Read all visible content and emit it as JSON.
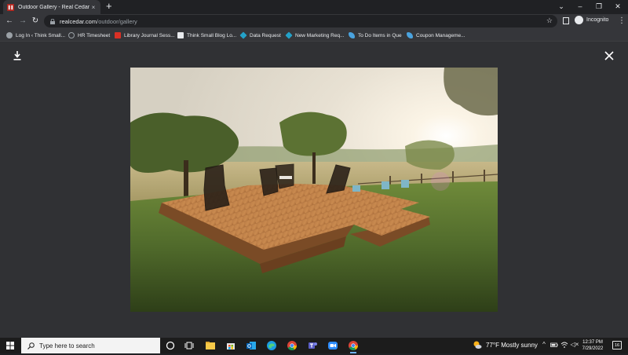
{
  "browser": {
    "tab_title": "Outdoor Gallery - Real Cedar",
    "tab_close": "×",
    "new_tab": "+",
    "window_controls": {
      "chevron": "⌄",
      "minimize": "–",
      "restore": "❐",
      "close": "✕"
    },
    "url_host": "realcedar.com",
    "url_path": "/outdoor/gallery",
    "star": "☆",
    "profile_label": "Incognito",
    "menu": "⋮",
    "nav": {
      "back": "←",
      "forward": "→",
      "reload": "↻"
    }
  },
  "bookmarks": [
    {
      "label": "Log In ‹ Think Small...",
      "icon": "wordpress-icon",
      "color": "#9aa0a6"
    },
    {
      "label": "HR Timesheet",
      "icon": "globe-icon",
      "color": "#9aa0a6"
    },
    {
      "label": "Library Journal Sess...",
      "icon": "library-journal-icon",
      "color": "#d93025"
    },
    {
      "label": "Think Small Blog Lo...",
      "icon": "blog-icon",
      "color": "#e8eaed"
    },
    {
      "label": "Data Request",
      "icon": "power-apps-icon",
      "color": "#23a1c8"
    },
    {
      "label": "New Marketing Req...",
      "icon": "power-apps-icon",
      "color": "#23a1c8"
    },
    {
      "label": "To Do Items in Que",
      "icon": "power-automate-icon",
      "color": "#4aa3df"
    },
    {
      "label": "Coupon Manageme...",
      "icon": "power-automate-icon",
      "color": "#4aa3df"
    }
  ],
  "viewer": {
    "close": "✕",
    "image_alt": "Cedar floating deck with chairs in a grassy field at sunset"
  },
  "taskbar": {
    "search_placeholder": "Type here to search",
    "weather": "77°F  Mostly sunny",
    "time": "12:37 PM",
    "date": "7/29/2022",
    "notifications": "16",
    "tray_chevron": "^",
    "volume": "◁×"
  },
  "colors": {
    "chrome_dark": "#202124",
    "toolbar": "#35363a",
    "viewer_bg": "#303134",
    "taskbar": "#1c1c1c",
    "accent": "#6fb1f5"
  }
}
